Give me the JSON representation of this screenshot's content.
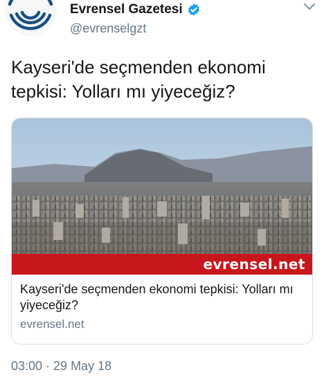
{
  "author": {
    "display_name": "Evrensel Gazetesi",
    "handle": "@evrenselgzt",
    "verified": true,
    "avatar_icon": "evrensel-logo-icon"
  },
  "tweet": {
    "text": "Kayseri'de seçmenden ekonomi tepkisi: Yolları mı yiyeceğiz?",
    "timestamp": "03:00 · 29 May 18"
  },
  "card": {
    "image_watermark": "evrensel.net",
    "title": "Kayseri'de seçmenden ekonomi tepkisi: Yolları mı yiyeceğiz?",
    "domain": "evrensel.net"
  },
  "colors": {
    "verified_blue": "#1da1f2",
    "watermark_red": "#c8171c",
    "secondary_text": "#657786",
    "logo_blue": "#1b4f86"
  }
}
